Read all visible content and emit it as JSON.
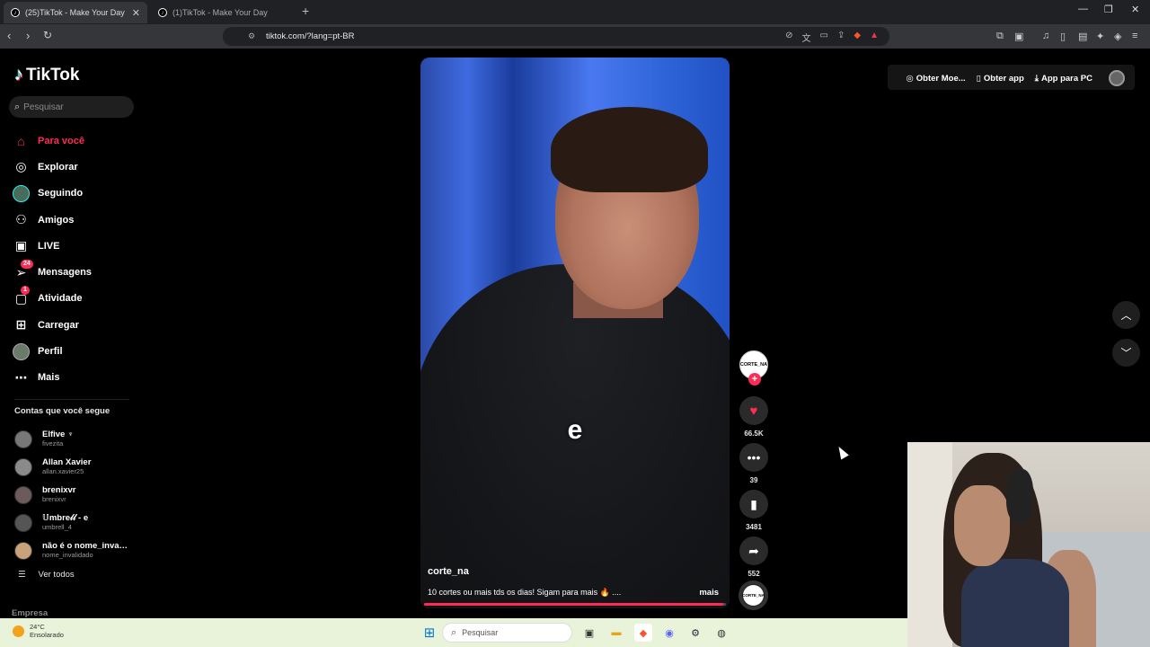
{
  "browser": {
    "tabs": [
      {
        "title": "(25)TikTok - Make Your Day",
        "active": true
      },
      {
        "title": "(1)TikTok - Make Your Day",
        "active": false
      }
    ],
    "new_tab": "+",
    "url": "tiktok.com/?lang=pt-BR"
  },
  "sidebar": {
    "logo": "TikTok",
    "search_placeholder": "Pesquisar",
    "nav": [
      {
        "label": "Para você",
        "icon": "home-icon",
        "active": true
      },
      {
        "label": "Explorar",
        "icon": "compass-icon"
      },
      {
        "label": "Seguindo",
        "icon": "following-avatar-icon"
      },
      {
        "label": "Amigos",
        "icon": "friends-icon"
      },
      {
        "label": "LIVE",
        "icon": "live-icon"
      },
      {
        "label": "Mensagens",
        "icon": "messages-icon",
        "badge": "24"
      },
      {
        "label": "Atividade",
        "icon": "activity-icon",
        "badge": "1"
      },
      {
        "label": "Carregar",
        "icon": "upload-icon"
      },
      {
        "label": "Perfil",
        "icon": "profile-avatar-icon"
      },
      {
        "label": "Mais",
        "icon": "more-icon"
      }
    ],
    "following_header": "Contas que você segue",
    "following": [
      {
        "name": "Elfive ♆",
        "handle": "fivezita"
      },
      {
        "name": "Allan Xavier",
        "handle": "allan.xavier25"
      },
      {
        "name": "brenixvr",
        "handle": "brenixvr"
      },
      {
        "name": "𝕌mbre𝓁𝓁 - e",
        "handle": "umbrell_4"
      },
      {
        "name": "não é o nome_invali...",
        "handle": "nome_invalidado"
      }
    ],
    "see_all": "Ver todos",
    "company": "Empresa"
  },
  "header": {
    "coins": "Obter Moe...",
    "get_app": "Obter app",
    "pc_app": "App para PC"
  },
  "video": {
    "caption_overlay": "e",
    "username": "corte_na",
    "description": "10 cortes ou mais tds os dias! Sigam para mais 🔥 ....",
    "more": "mais",
    "progress": 0.99,
    "creator_avatar_text": "CORTE_NA",
    "likes": "66.5K",
    "comments": "39",
    "saves": "3481",
    "shares": "552"
  },
  "taskbar": {
    "temp": "24°C",
    "condition": "Ensolarado",
    "search_placeholder": "Pesquisar"
  },
  "colors": {
    "accent": "#fe2c55",
    "background": "#000000"
  }
}
